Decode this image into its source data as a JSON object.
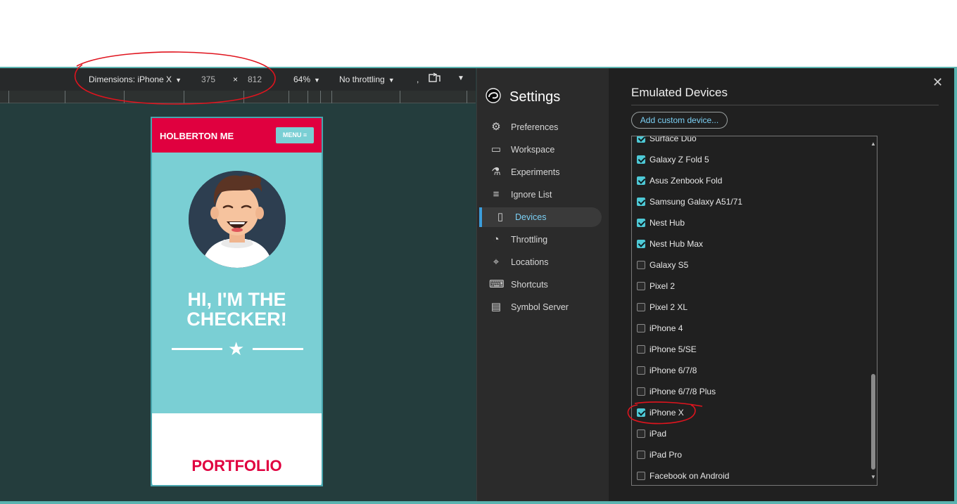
{
  "toolbar": {
    "dimensions_label": "Dimensions: iPhone X",
    "width_value": "375",
    "times": "×",
    "height_value": "812",
    "zoom": "64%",
    "throttling": "No throttling",
    "separator": ",",
    "rotate_icon": "rotate-icon",
    "more_icon": "chevron-down-icon"
  },
  "phone": {
    "brand": "HOLBERTON ME",
    "menu_label": "MENU ≡",
    "hero_line1": "HI, I'M THE",
    "hero_line2": "CHECKER!",
    "star": "★",
    "portfolio": "PORTFOLIO"
  },
  "settings": {
    "title": "Settings",
    "nav": [
      {
        "label": "Preferences",
        "icon": "⚙"
      },
      {
        "label": "Workspace",
        "icon": "▭"
      },
      {
        "label": "Experiments",
        "icon": "⚗"
      },
      {
        "label": "Ignore List",
        "icon": "≡"
      },
      {
        "label": "Devices",
        "icon": "▯"
      },
      {
        "label": "Throttling",
        "icon": "◔"
      },
      {
        "label": "Locations",
        "icon": "⌖"
      },
      {
        "label": "Shortcuts",
        "icon": "⌨"
      },
      {
        "label": "Symbol Server",
        "icon": "▤"
      }
    ],
    "main_title": "Emulated Devices",
    "add_button": "Add custom device...",
    "close_icon": "close-icon",
    "devices": [
      {
        "label": "Surface Duo",
        "checked": true
      },
      {
        "label": "Galaxy Z Fold 5",
        "checked": true
      },
      {
        "label": "Asus Zenbook Fold",
        "checked": true
      },
      {
        "label": "Samsung Galaxy A51/71",
        "checked": true
      },
      {
        "label": "Nest Hub",
        "checked": true
      },
      {
        "label": "Nest Hub Max",
        "checked": true
      },
      {
        "label": "Galaxy S5",
        "checked": false
      },
      {
        "label": "Pixel 2",
        "checked": false
      },
      {
        "label": "Pixel 2 XL",
        "checked": false
      },
      {
        "label": "iPhone 4",
        "checked": false
      },
      {
        "label": "iPhone 5/SE",
        "checked": false
      },
      {
        "label": "iPhone 6/7/8",
        "checked": false
      },
      {
        "label": "iPhone 6/7/8 Plus",
        "checked": false
      },
      {
        "label": "iPhone X",
        "checked": true
      },
      {
        "label": "iPad",
        "checked": false
      },
      {
        "label": "iPad Pro",
        "checked": false
      },
      {
        "label": "Facebook on Android",
        "checked": false
      }
    ]
  },
  "colors": {
    "brand_red": "#e0003f",
    "phone_teal": "#7acfd4",
    "accent_blue": "#7bd0f5",
    "annotation_red": "#e0141e"
  }
}
